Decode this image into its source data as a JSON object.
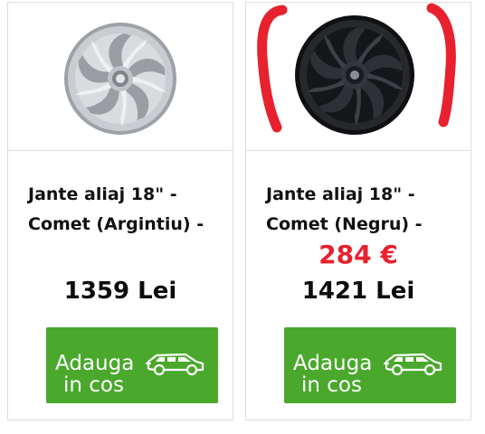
{
  "products": [
    {
      "title_line1": "Jante aliaj 18\" -",
      "title_line2": "Comet (Argintiu) -",
      "price": "1359 Lei",
      "button_line1": "Adauga",
      "button_line2": "in cos",
      "wheel_color": "#b9bcc0",
      "icon": "car-icon"
    },
    {
      "title_line1": "Jante aliaj 18\" -",
      "title_line2": "Comet (Negru) -",
      "annotation_price": "284 €",
      "price": "1421 Lei",
      "button_line1": "Adauga",
      "button_line2": "in cos",
      "wheel_color": "#1c1d20",
      "icon": "car-icon"
    }
  ],
  "colors": {
    "button_green": "#4aa82c",
    "annotation_red": "#e8212f",
    "border": "#dddddd"
  }
}
